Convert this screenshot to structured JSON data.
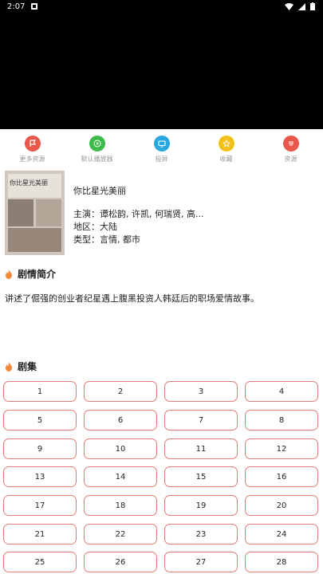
{
  "status_bar": {
    "time": "2:07"
  },
  "actions": [
    {
      "label": "更多资源",
      "color": "#e8574a",
      "icon": "flag-icon"
    },
    {
      "label": "默认播放器",
      "color": "#3dbb4a",
      "icon": "play-icon"
    },
    {
      "label": "投屏",
      "color": "#29a8e0",
      "icon": "tv-icon"
    },
    {
      "label": "收藏",
      "color": "#f2c017",
      "icon": "star-icon"
    },
    {
      "label": "资源",
      "color": "#e8574a",
      "icon": "source-icon"
    }
  ],
  "poster": {
    "title_text": "你比星光美丽"
  },
  "show": {
    "title": "你比星光美丽",
    "cast": "主演：谭松韵, 许凯, 何瑞贤, 高...",
    "region": "地区：大陆",
    "genre": "类型：言情, 都市"
  },
  "synopsis": {
    "heading": "剧情简介",
    "text": "讲述了倔强的创业者纪星遇上腹黑投资人韩廷后的职场爱情故事。"
  },
  "episodes": {
    "heading": "剧集",
    "items": [
      "1",
      "2",
      "3",
      "4",
      "5",
      "6",
      "7",
      "8",
      "9",
      "10",
      "11",
      "12",
      "13",
      "14",
      "15",
      "16",
      "17",
      "18",
      "19",
      "20",
      "21",
      "22",
      "23",
      "24",
      "25",
      "26",
      "27",
      "28"
    ]
  },
  "colors": {
    "accent": "#e37c74",
    "flame": "#f08a3c"
  }
}
